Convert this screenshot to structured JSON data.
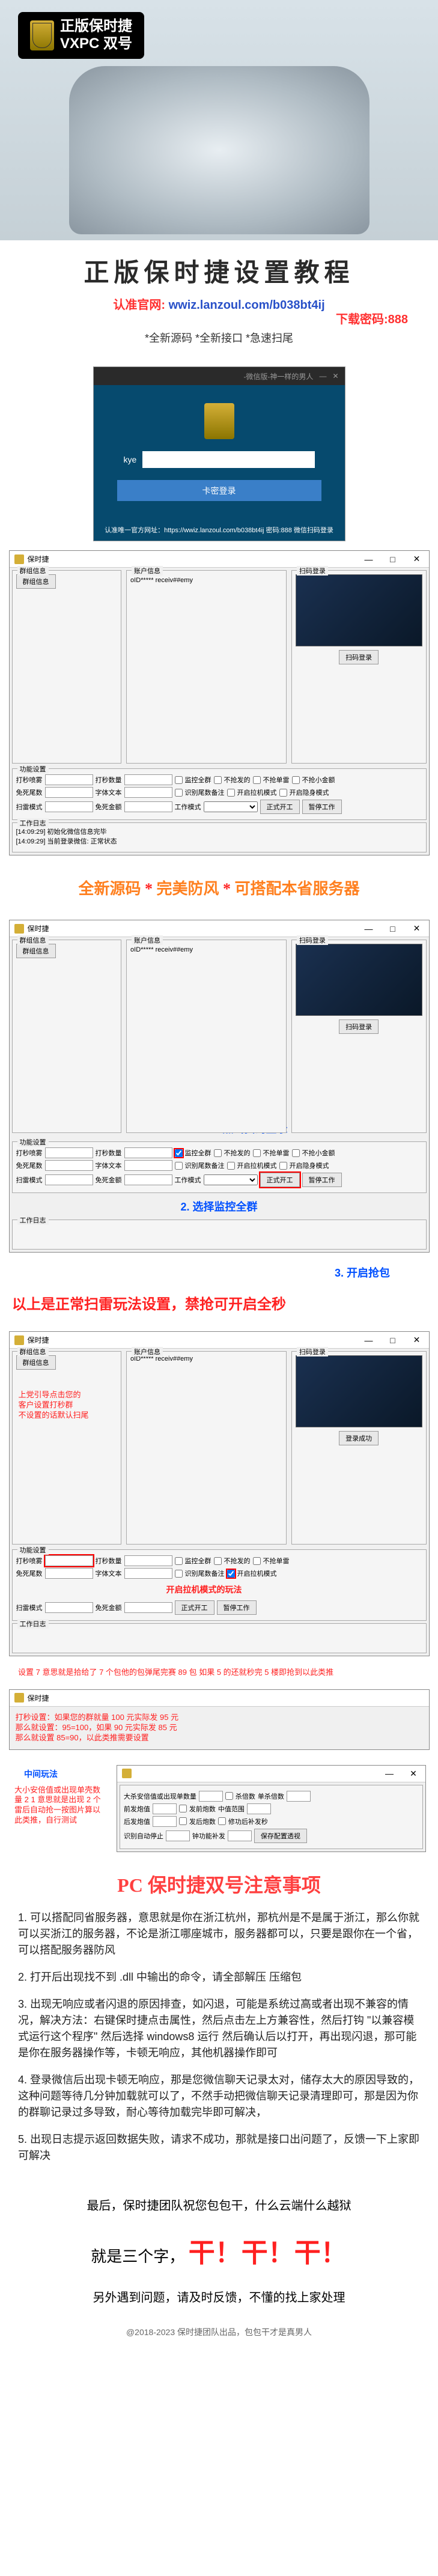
{
  "hero": {
    "badge_line1": "正版保时捷",
    "badge_line2": "VXPC 双号"
  },
  "title_section": {
    "main_title": "正版保时捷设置教程",
    "official_label": "认准官网:",
    "official_url": "wwiz.lanzoul.com/b038bt4ij",
    "download_pwd": "下载密码:888",
    "subtitle": "*全新源码 *全新接口 *急速扫尾"
  },
  "login": {
    "header_text": "-微信版-神一样的男人",
    "input_label": "kye",
    "placeholder": "",
    "button": "卡密登录",
    "footer": "认准唯一官方网址：https://wwiz.lanzoul.com/b038bt4ij 密码:888 微信扫码登录"
  },
  "app": {
    "title": "保时捷",
    "panels": {
      "group_info": "群组信息",
      "account_info": "账户信息",
      "scan_login": "扫码登录",
      "work_log": "工作日志"
    },
    "group_info_btn": "群组信息",
    "account_value": "oID***** receiv##emy",
    "scan_btn": "扫码登录",
    "login_success_btn": "登录成功",
    "form": {
      "section_func": "功能设置",
      "section_log": "工作日志",
      "monitor_group": "打秒喷雾",
      "tail_no": "打秒数量",
      "avoid_no": "免死尾数",
      "thunder_mode": "扫雷模式",
      "monitor_all": "监控全群",
      "no_grab_send": "不抢发的",
      "no_grab_single": "不抢单雷",
      "no_grab_smallest": "不抢小金额",
      "identify_remark": "识别尾数备注",
      "slot_machine": "开启拉机模式",
      "cloak": "开启隐身模式",
      "start_work": "正式开工",
      "pause_work": "暂停工作",
      "login_btn2": "登录成功",
      "principal": "字体文本",
      "avoid_principal": "免死金额",
      "work_mode": "工作模式"
    },
    "log_lines": [
      "[14:09:29] 初始化微信信息完毕",
      "[14:09:29] 当前登录微信: 正常状态"
    ]
  },
  "banner1": {
    "text_a": "全新源码",
    "text_b": "完美防风",
    "text_c": "可搭配本省服务器"
  },
  "step1": "1. 点击扫码登录",
  "step2": "2. 选择监控全群",
  "step3": "3. 开启抢包",
  "banner2": "以上是正常扫雷玩法设置，禁抢可开启全秒",
  "note1": {
    "line1": "上党引导点击您的",
    "line2": "客户设置打秒群",
    "line3": "不设置的话默认扫尾"
  },
  "note2": "开启拉机模式的玩法",
  "note3": "设置 7 意思就是拾给了 7 个包他的包弹尾完赛 89 包 如果 5 的还就秒完 5 楼即抢到以此类推",
  "note4": {
    "line1": "打秒设置：如果您的群就量 100 元实际发 95 元",
    "line2": "那么就设置：95=100，如果 90 元实际发 85 元",
    "line3": "那么就设置 85=90，以此类推需要设置"
  },
  "note5": "中间玩法",
  "note6": "大小安倍值或出现单壳数量 2 1 意思就是出现 2 个雷后自动抢一按图片算以此类推，自行测试",
  "app2": {
    "fields": {
      "dasha_text": "大杀安倍值或出现单数量",
      "single_kill": "单杀倍数",
      "front_pao": "前发炮值",
      "back_pao": "后发炮值",
      "auto_stop": "识别自动停止",
      "clock_repair": "钟功能补发",
      "kill_check": "杀倍数",
      "front_check": "发前炮数",
      "back_check": "发后炮数",
      "middle_range": "中值范围",
      "repair_check": "修功后补发秒"
    }
  },
  "notice": {
    "title": "PC 保时捷双号注意事项",
    "items": [
      "1. 可以搭配同省服务器，意思就是你在浙江杭州，那杭州是不是属于浙江，那么你就可以买浙江的服务器，不论是浙江哪座城市，服务器都可以，只要是跟你在一个省，可以搭配服务器防风",
      "2. 打开后出现找不到 .dll 中输出的命令，请全部解压 压缩包",
      "3. 出现无响应或者闪退的原因排查，如闪退，可能是系统过高或者出现不兼容的情况，解决方法：右键保时捷点击属性，然后点击左上方兼容性，然后打钩 \"以兼容模式运行这个程序\" 然后选择 windows8 运行 然后确认后以打开，再出现闪退，那可能是你在服务器操作等，卡顿无响应，其他机器操作即可",
      "4. 登录微信后出现卡顿无响应，那是您微信聊天记录太对，储存太大的原因导致的，这种问题等待几分钟加载就可以了，不然手动把微信聊天记录清理即可，那是因为你的群聊记录过多导致，耐心等待加载完毕即可解决，",
      "5. 出现日志提示返回数据失败，请求不成功，那就是接口出问题了，反馈一下上家即可解决"
    ]
  },
  "footer": {
    "line1": "最后，保时捷团队祝您包包干，什么云端什么越狱",
    "line2_a": "就是三个字，",
    "line2_b": "干！干！干！",
    "line3": "另外遇到问题，请及时反馈，不懂的找上家处理",
    "copyright": "@2018-2023 保时捷团队出品，包包干才是真男人"
  }
}
